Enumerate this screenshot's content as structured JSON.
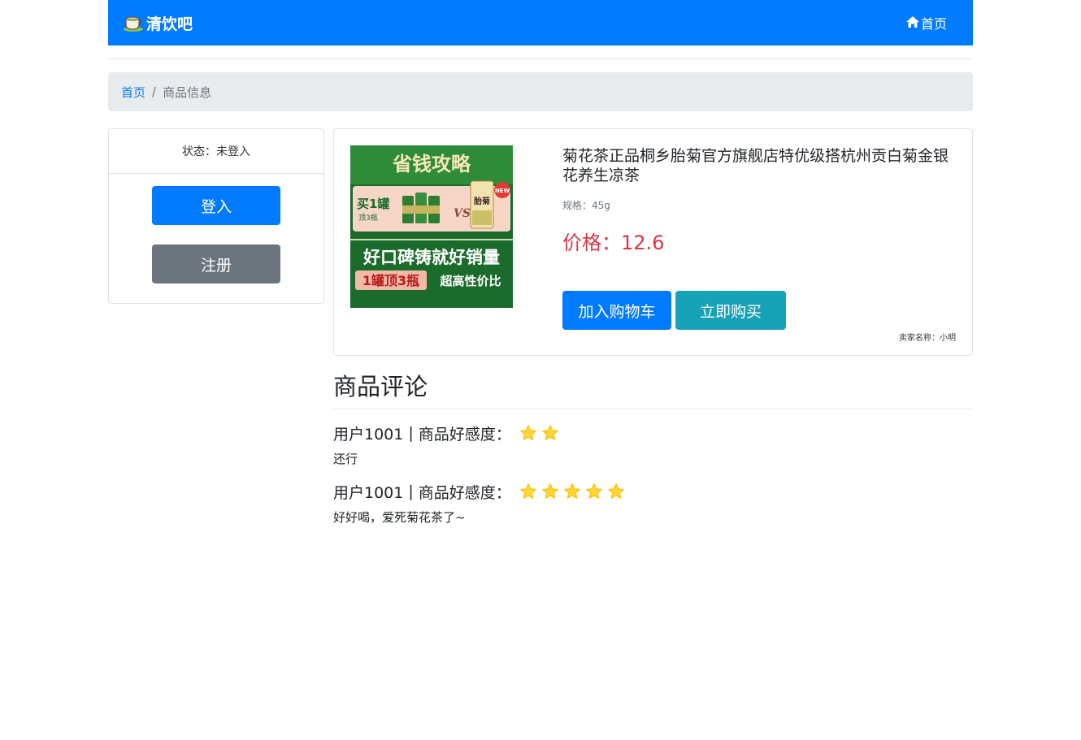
{
  "navbar": {
    "brand": "清饮吧",
    "brand_icon": "tea-cup-icon",
    "home_label": "首页",
    "home_icon": "home-icon",
    "bg_color": "#007bff"
  },
  "breadcrumb": {
    "items": [
      "首页",
      "商品信息"
    ],
    "separator": "/"
  },
  "sidebar": {
    "status_label": "状态：",
    "status_value": "未登入",
    "login_label": "登入",
    "register_label": "注册"
  },
  "product": {
    "title": "菊花茶正品桐乡胎菊官方旗舰店特优级搭杭州贡白菊金银花养生凉茶",
    "spec": "规格：45g",
    "price_label": "价格：",
    "price": "12.6",
    "price_color": "#dc3545",
    "add_to_cart_label": "加入购物车",
    "buy_now_label": "立即购买",
    "seller": "卖家名称：小明",
    "image": {
      "headline": "省钱攻略",
      "offer_main": "买1罐",
      "offer_sub": "顶3瓶",
      "vs": "VS",
      "new_badge": "NEW",
      "jar_label": "胎菊",
      "slogan": "好口碑铸就好销量",
      "promo_a": "1罐顶3瓶",
      "promo_b": "超高性价比"
    }
  },
  "reviews": {
    "title": "商品评论",
    "items": [
      {
        "user": "用户1001",
        "rating_label": "商品好感度：",
        "stars": 2,
        "text": "还行"
      },
      {
        "user": "用户1001",
        "rating_label": "商品好感度：",
        "stars": 5,
        "text": "好好喝，爱死菊花茶了~"
      }
    ],
    "star_color": "#fdd835"
  }
}
